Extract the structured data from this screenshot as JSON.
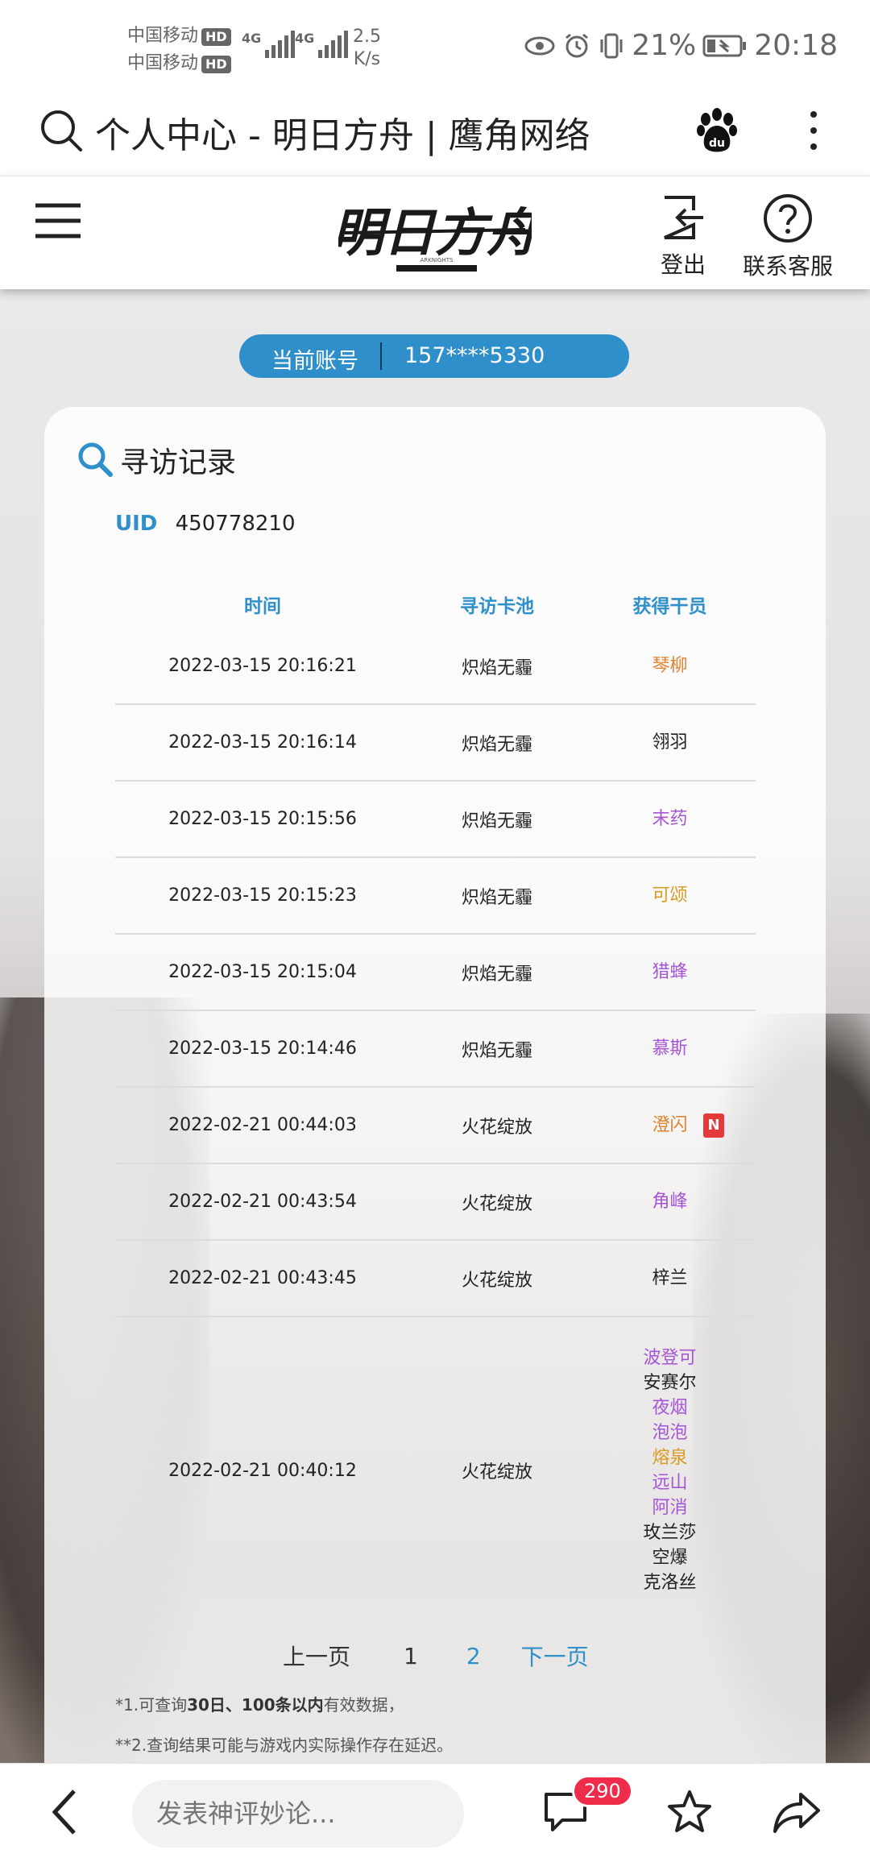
{
  "status_bar": {
    "carrier1": "中国移动",
    "carrier2": "中国移动",
    "hd": "HD",
    "net1": "4G",
    "net2": "4G",
    "speed_value": "2.5",
    "speed_unit": "K/s",
    "battery": "21%",
    "time": "20:18"
  },
  "browser": {
    "page_title": "个人中心 - 明日方舟 | 鹰角网络"
  },
  "header": {
    "logo_text": "明日方舟",
    "logo_sub": "ARKNIGHTS",
    "logout_label": "登出",
    "support_label": "联系客服"
  },
  "account": {
    "label": "当前账号",
    "value": "157****5330"
  },
  "card": {
    "title": "寻访记录",
    "uid_label": "UID",
    "uid_value": "450778210"
  },
  "table": {
    "headers": {
      "time": "时间",
      "pool": "寻访卡池",
      "operator": "获得干员"
    },
    "rows": [
      {
        "time": "2022-03-15 20:16:21",
        "pool": "炽焰无霾",
        "ops": [
          {
            "name": "琴柳",
            "color": "#e0822d"
          }
        ]
      },
      {
        "time": "2022-03-15 20:16:14",
        "pool": "炽焰无霾",
        "ops": [
          {
            "name": "翎羽",
            "color": "#222222"
          }
        ]
      },
      {
        "time": "2022-03-15 20:15:56",
        "pool": "炽焰无霾",
        "ops": [
          {
            "name": "末药",
            "color": "#a455d6"
          }
        ]
      },
      {
        "time": "2022-03-15 20:15:23",
        "pool": "炽焰无霾",
        "ops": [
          {
            "name": "可颂",
            "color": "#d99a21"
          }
        ]
      },
      {
        "time": "2022-03-15 20:15:04",
        "pool": "炽焰无霾",
        "ops": [
          {
            "name": "猎蜂",
            "color": "#a455d6"
          }
        ]
      },
      {
        "time": "2022-03-15 20:14:46",
        "pool": "炽焰无霾",
        "ops": [
          {
            "name": "慕斯",
            "color": "#a455d6"
          }
        ]
      },
      {
        "time": "2022-02-21 00:44:03",
        "pool": "火花绽放",
        "ops": [
          {
            "name": "澄闪",
            "color": "#e0822d"
          }
        ],
        "badge": "N"
      },
      {
        "time": "2022-02-21 00:43:54",
        "pool": "火花绽放",
        "ops": [
          {
            "name": "角峰",
            "color": "#a455d6"
          }
        ]
      },
      {
        "time": "2022-02-21 00:43:45",
        "pool": "火花绽放",
        "ops": [
          {
            "name": "梓兰",
            "color": "#222222"
          }
        ]
      },
      {
        "time": "2022-02-21 00:40:12",
        "pool": "火花绽放",
        "ops": [
          {
            "name": "波登可",
            "color": "#a455d6"
          },
          {
            "name": "安赛尔",
            "color": "#222222"
          },
          {
            "name": "夜烟",
            "color": "#a455d6"
          },
          {
            "name": "泡泡",
            "color": "#a455d6"
          },
          {
            "name": "熔泉",
            "color": "#d99a21"
          },
          {
            "name": "远山",
            "color": "#a455d6"
          },
          {
            "name": "阿消",
            "color": "#a455d6"
          },
          {
            "name": "玫兰莎",
            "color": "#222222"
          },
          {
            "name": "空爆",
            "color": "#222222"
          },
          {
            "name": "克洛丝",
            "color": "#222222"
          }
        ]
      }
    ]
  },
  "pagination": {
    "prev": "上一页",
    "page1": "1",
    "page2": "2",
    "next": "下一页"
  },
  "notes": {
    "n1_prefix": "*1.可查询",
    "n1_bold": "30日、100条以内",
    "n1_suffix": "有效数据，",
    "n2": "**2.查询结果可能与游戏内实际操作存在延迟。"
  },
  "bottom_bar": {
    "comment_placeholder": "发表神评妙论...",
    "comment_count": "290"
  },
  "colors": {
    "accent_blue": "#2f8fcb",
    "badge_red": "#e33b3b",
    "six_star": "#e0822d",
    "five_star": "#d99a21",
    "four_star": "#a455d6"
  }
}
